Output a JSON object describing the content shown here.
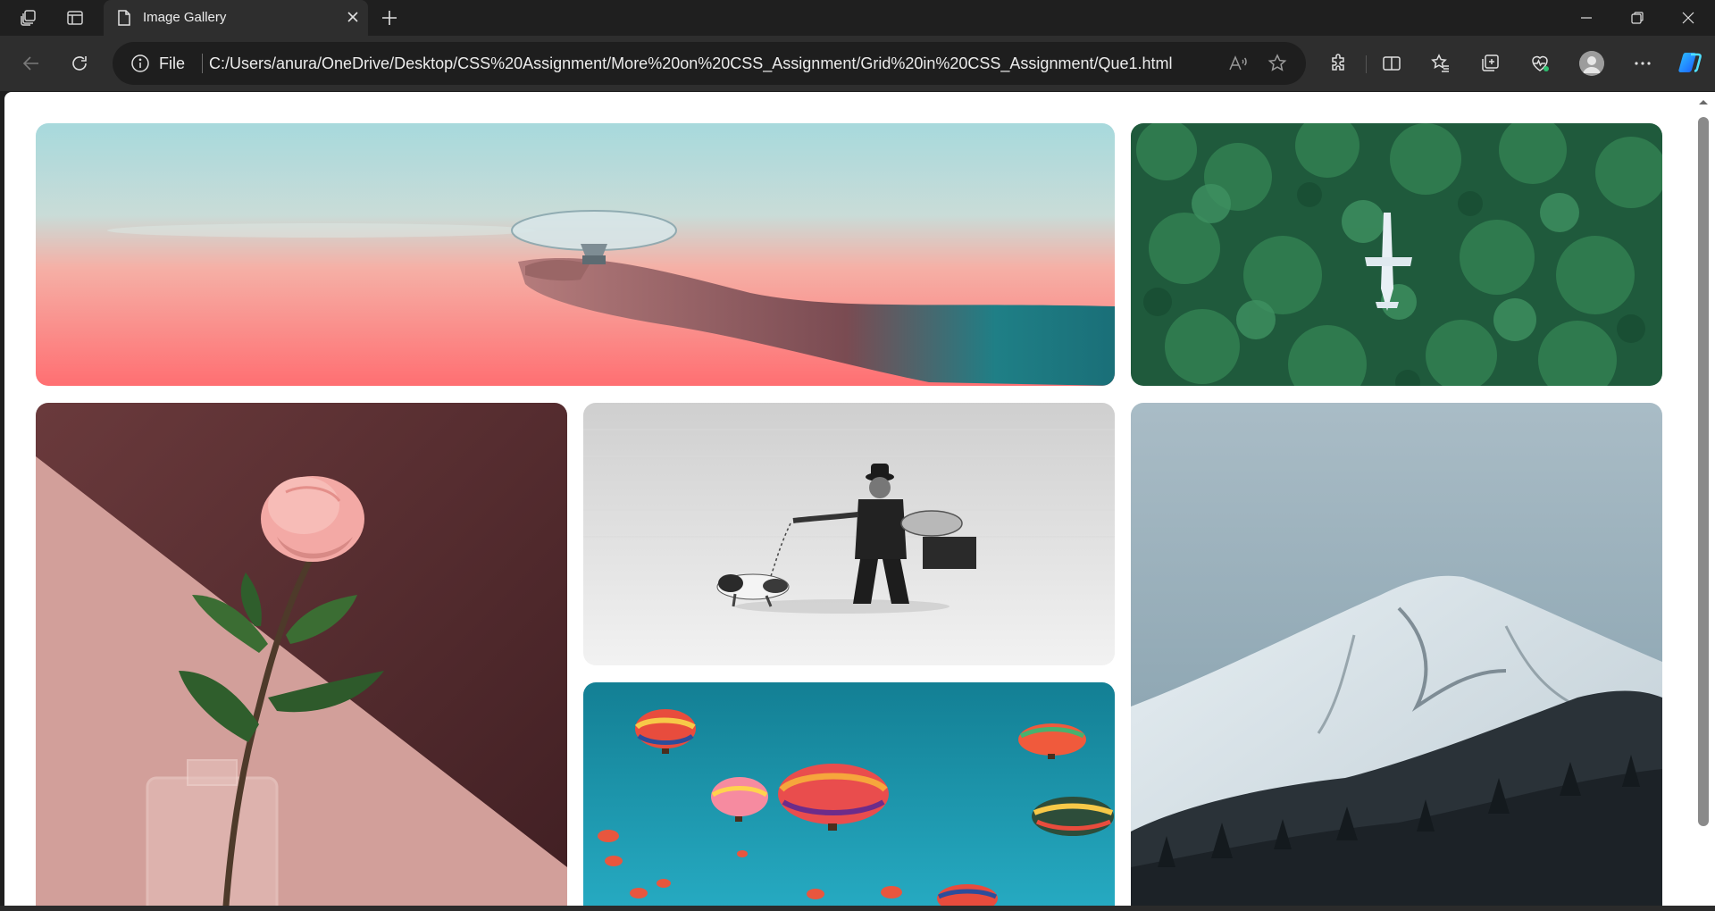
{
  "browser": {
    "tab_title": "Image Gallery",
    "address_scheme": "File",
    "address_url": "C:/Users/anura/OneDrive/Desktop/CSS%20Assignment/More%20on%20CSS_Assignment/Grid%20in%20CSS_Assignment/Que1.html",
    "accent_color": "#3b82f6"
  },
  "gallery": {
    "images": [
      {
        "name": "hand-holding-lightbulb",
        "subject": "hand holding glass bulb against pastel sky"
      },
      {
        "name": "airplane-in-forest",
        "subject": "airplane among pine trees"
      },
      {
        "name": "rose-in-vase",
        "subject": "pink rose in glass vase"
      },
      {
        "name": "man-walking-dog",
        "subject": "man with briefcase walking a dog"
      },
      {
        "name": "snowy-mountain",
        "subject": "snow capped mountain"
      },
      {
        "name": "hot-air-balloons",
        "subject": "hot air balloons in blue sky"
      }
    ]
  },
  "icons": {
    "workspaces": "workspaces-icon",
    "tab_actions": "tab-actions-icon",
    "page": "page-icon",
    "close": "close-icon",
    "new_tab": "plus-icon",
    "back": "back-arrow-icon",
    "refresh": "refresh-icon",
    "info": "info-icon",
    "read_aloud": "read-aloud-icon",
    "favorite": "star-icon",
    "extensions": "puzzle-icon",
    "split_screen": "split-screen-icon",
    "favorites": "favorites-icon",
    "collections": "collections-icon",
    "browser_essentials": "heart-pulse-icon",
    "profile": "profile-icon",
    "more": "more-icon",
    "copilot": "copilot-icon"
  }
}
